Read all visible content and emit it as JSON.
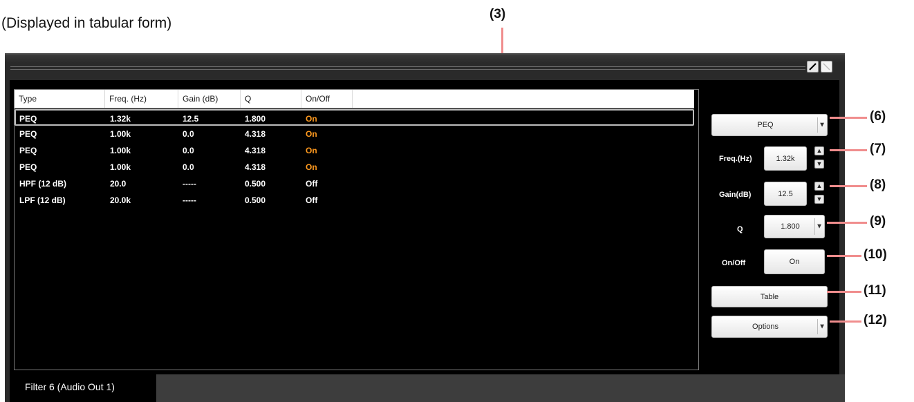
{
  "caption": "(Displayed in tabular form)",
  "callouts": [
    "(3)",
    "(6)",
    "(7)",
    "(8)",
    "(9)",
    "(10)",
    "(11)",
    "(12)"
  ],
  "window": {
    "buttons": [
      "pencil-icon",
      "restore-icon"
    ]
  },
  "table": {
    "columns": [
      "Type",
      "Freq. (Hz)",
      "Gain (dB)",
      "Q",
      "On/Off"
    ],
    "rows": [
      {
        "type": "PEQ",
        "freq": "1.32k",
        "gain": "12.5",
        "q": "1.800",
        "onoff": "On",
        "selected": true
      },
      {
        "type": "PEQ",
        "freq": "1.00k",
        "gain": "0.0",
        "q": "4.318",
        "onoff": "On"
      },
      {
        "type": "PEQ",
        "freq": "1.00k",
        "gain": "0.0",
        "q": "4.318",
        "onoff": "On"
      },
      {
        "type": "PEQ",
        "freq": "1.00k",
        "gain": "0.0",
        "q": "4.318",
        "onoff": "On"
      },
      {
        "type": "HPF (12 dB)",
        "freq": "20.0",
        "gain": "-----",
        "q": "0.500",
        "onoff": "Off"
      },
      {
        "type": "LPF (12 dB)",
        "freq": "20.0k",
        "gain": "-----",
        "q": "0.500",
        "onoff": "Off"
      }
    ]
  },
  "controls": {
    "type_select": "PEQ",
    "freq_label": "Freq.(Hz)",
    "freq_value": "1.32k",
    "gain_label": "Gain(dB)",
    "gain_value": "12.5",
    "q_label": "Q",
    "q_value": "1.800",
    "onoff_label": "On/Off",
    "onoff_value": "On",
    "table_button": "Table",
    "options_button": "Options"
  },
  "tab": {
    "label": "Filter 6 (Audio Out 1)"
  },
  "colors": {
    "on": "#ff9a1f",
    "callout_line": "#f08d8d"
  }
}
